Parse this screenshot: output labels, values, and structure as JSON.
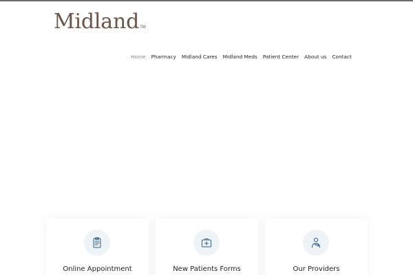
{
  "brand": {
    "name": "Midland",
    "trademark": "TM",
    "color": "#6d5448"
  },
  "nav": {
    "items": [
      {
        "label": "Home"
      },
      {
        "label": "Pharmacy"
      },
      {
        "label": "Midland Cares"
      },
      {
        "label": "Midland Meds"
      },
      {
        "label": "Patient Center"
      },
      {
        "label": "About us"
      },
      {
        "label": "Contact"
      }
    ],
    "active_item": "Home"
  },
  "cards": [
    {
      "title": "Online Appointment",
      "icon": "clipboard-icon"
    },
    {
      "title": "New Patients Forms",
      "icon": "medical-kit-icon"
    },
    {
      "title": "Our Providers",
      "icon": "doctor-icon"
    }
  ],
  "colors": {
    "icon_stroke": "#2f5d8c",
    "icon_bg": "#eef3f8",
    "text": "#222222",
    "nav_active": "#8a8a8a"
  }
}
